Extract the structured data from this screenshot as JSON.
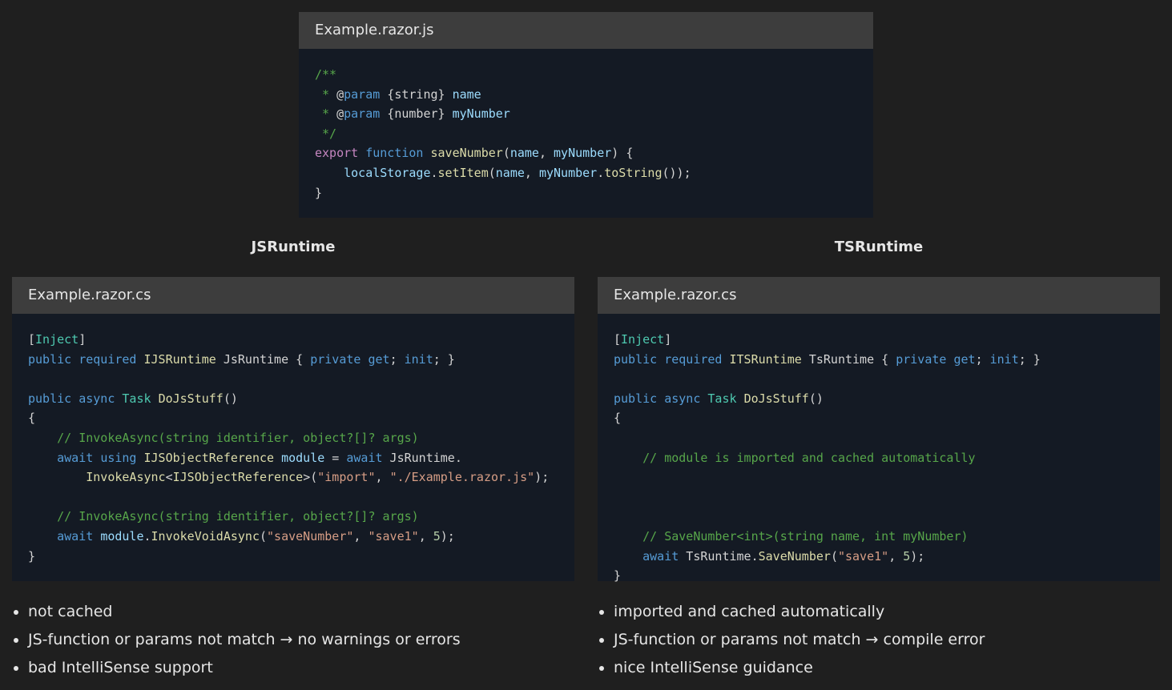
{
  "top_panel": {
    "filename": "Example.razor.js"
  },
  "left": {
    "title": "JSRuntime",
    "filename": "Example.razor.cs",
    "notes": [
      "not cached",
      "JS-function or params not match → no warnings or errors",
      "bad IntelliSense support"
    ]
  },
  "right": {
    "title": "TSRuntime",
    "filename": "Example.razor.cs",
    "notes": [
      "imported and cached automatically",
      "JS-function or params not match → compile error",
      "nice IntelliSense guidance"
    ]
  },
  "colors": {
    "background": "#1f1f1f",
    "panel_header": "#3d3d3d",
    "code_background": "#141a24",
    "comment": "#57a64a",
    "keyword": "#569cd6",
    "type": "#4ec9b0",
    "function": "#dcdcaa",
    "string": "#d69d85"
  }
}
